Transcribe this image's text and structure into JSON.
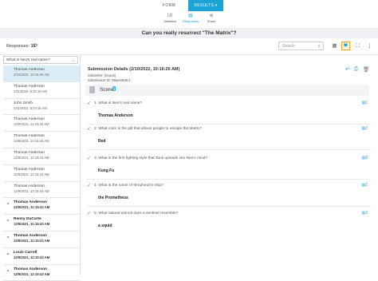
{
  "tabs": {
    "form": "FORM",
    "results": "RESULTS",
    "results_caret": "▾"
  },
  "subnav": [
    {
      "icon": "UI",
      "label": "Statistics"
    },
    {
      "icon": "▤",
      "label": "Responses"
    },
    {
      "icon": "⋞",
      "label": "Share"
    }
  ],
  "form_title": "Can you really resurrect \"The Matrix\"?",
  "toolbar": {
    "responses_label": "Responses:",
    "responses_count": "15",
    "search_placeholder": "Search"
  },
  "filter": {
    "selected": "What is Neo's real name?"
  },
  "responses": [
    {
      "name": "Thomas Anderson",
      "date": "2/10/2022, 10:16:26 AM",
      "selected": true,
      "unread": false
    },
    {
      "name": "Thomas Anderson",
      "date": "1/11/2022, 8:20:16 AM",
      "selected": false,
      "unread": false
    },
    {
      "name": "John Smith",
      "date": "1/11/2022, 8:24:16 AM",
      "selected": false,
      "unread": false
    },
    {
      "name": "Thomas Anderson",
      "date": "12/8/2021, 12:15:43 AM",
      "selected": false,
      "unread": false
    },
    {
      "name": "Thomas Anderson",
      "date": "12/8/2021, 12:15:43 AM",
      "selected": false,
      "unread": false
    },
    {
      "name": "Thomas Anderson",
      "date": "12/8/2021, 12:15:43 AM",
      "selected": false,
      "unread": false
    },
    {
      "name": "Thomas Anderson",
      "date": "12/8/2021, 12:15:43 AM",
      "selected": false,
      "unread": false
    },
    {
      "name": "Thomas Anderson",
      "date": "12/9/2021, 12:15:43 AM",
      "selected": false,
      "unread": false
    },
    {
      "name": "Thomas Anderson",
      "date": "12/9/2021, 12:15:43 AM",
      "selected": false,
      "unread": true
    },
    {
      "name": "Renny DuCarte",
      "date": "12/9/2021, 12:15:43 AM",
      "selected": false,
      "unread": true
    },
    {
      "name": "Thomas Anderson",
      "date": "12/9/2021, 12:15:43 AM",
      "selected": false,
      "unread": true
    },
    {
      "name": "Louis Carrell",
      "date": "12/9/2021, 12:15:43 AM",
      "selected": false,
      "unread": true
    },
    {
      "name": "Thomas Anderson",
      "date": "12/9/2021, 12:15:43 AM",
      "selected": false,
      "unread": true
    }
  ],
  "submission": {
    "title": "Submission Details (2/10/2022, 10:16:26 AM)",
    "submitter": "Submitter: (Guest)",
    "id": "Submission ID: 09a2e6b3c1",
    "score_label": "Score:",
    "score_value": "8"
  },
  "questions": [
    {
      "text": "1. What is Neo's real name?",
      "answer": "Thomas Anderson",
      "badge": "1"
    },
    {
      "text": "2. What color is the pill that allows people to escape the Matrix?",
      "answer": "Red",
      "badge": "2"
    },
    {
      "text": "3. What is the first fighting style that Tank uploads into Neo's mind?",
      "answer": "Kung Fu",
      "badge": "2"
    },
    {
      "text": "4. What is the name of Morpheus's ship?",
      "answer": "the Prometheus",
      "badge": "2"
    },
    {
      "text": "5. What natural animal does a sentinel resemble?",
      "answer": "a squid",
      "badge": "2"
    }
  ],
  "icons": {
    "refresh": "⟳",
    "search": "⌕",
    "grid": "▦",
    "calendar": "▣",
    "fullscreen": "⛶",
    "more": "⋮",
    "chevron": "⌄",
    "reply": "↶",
    "print": "⎙",
    "delete": "🗑",
    "check": "✓",
    "badge": "▤"
  },
  "colors": {
    "accent": "#1ba3d6",
    "unread": "#d9534f",
    "check": "#3aa757",
    "highlight": "#f0a500"
  }
}
